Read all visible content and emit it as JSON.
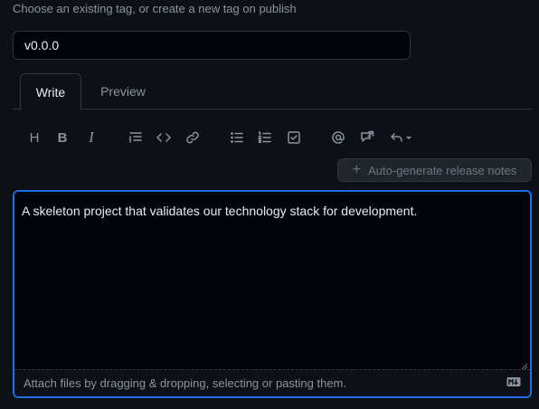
{
  "tag": {
    "hint": "Choose an existing tag, or create a new tag on publish",
    "value": "v0.0.0"
  },
  "tabs": [
    {
      "label": "Write",
      "active": true
    },
    {
      "label": "Preview",
      "active": false
    }
  ],
  "toolbar": {
    "heading_label": "H",
    "bold_label": "B",
    "italic_label": "I"
  },
  "autogen": {
    "plus": "+",
    "label": "Auto-generate release notes"
  },
  "editor": {
    "body": "A skeleton project that validates our technology stack for development.",
    "attach_text": "Attach files by dragging & dropping, selecting or pasting them."
  },
  "colors": {
    "background": "#0d1117",
    "focus_border": "#1f6feb",
    "muted_text": "#8b949e",
    "text": "#e6edf3"
  }
}
